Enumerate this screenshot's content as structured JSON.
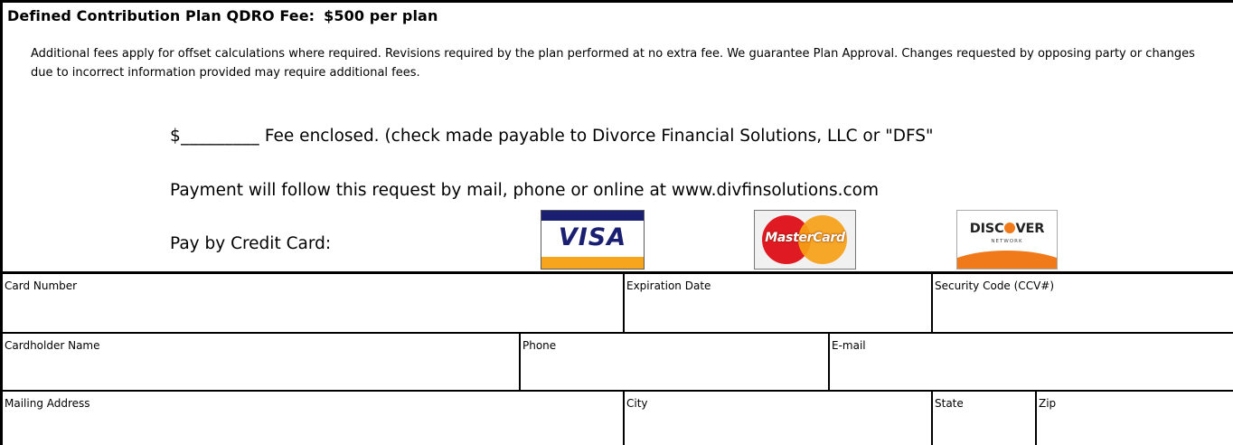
{
  "heading": {
    "title": "Defined Contribution Plan QDRO Fee:",
    "price": "$500 per plan"
  },
  "notes": "Additional fees apply for offset calculations where required.  Revisions required by the plan performed at no extra fee.  We guarantee Plan Approval.  Changes requested by opposing party or changes due to incorrect information provided may require additional fees.",
  "payment": {
    "fee_blank": "$_________",
    "fee_text": " Fee enclosed.  (check made payable to Divorce Financial Solutions, LLC or \"DFS\"",
    "follow_text": "Payment will follow this request by mail, phone or online at www.divfinsolutions.com",
    "credit_label": "Pay by Credit Card:"
  },
  "logos": {
    "visa": "VISA",
    "mastercard": "MasterCard",
    "discover_left": "DISC",
    "discover_right": "VER",
    "discover_network": "NETWORK"
  },
  "form": {
    "row1": [
      "Card Number",
      "Expiration Date",
      "Security Code (CCV#)"
    ],
    "row2": [
      "Cardholder Name",
      "Phone",
      "E-mail"
    ],
    "row3": [
      "Mailing Address",
      "City",
      "State",
      "Zip"
    ]
  },
  "colors": {
    "visa_blue": "#1a1f71",
    "visa_gold": "#f7a51c",
    "mastercard_red": "#e01a22",
    "mastercard_orange": "#f7a116",
    "discover_orange": "#f07a1a"
  }
}
